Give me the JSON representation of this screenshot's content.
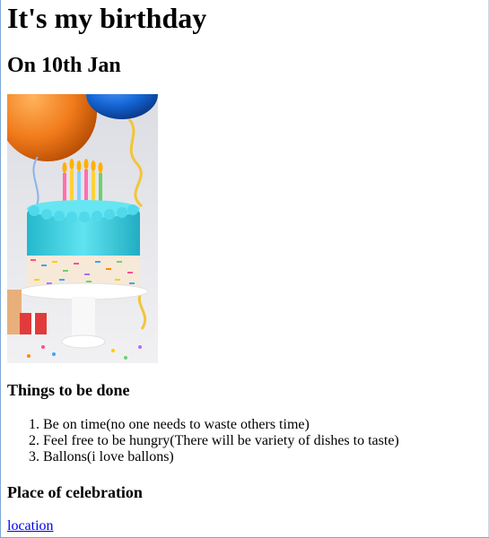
{
  "page": {
    "title": "It's my birthday",
    "subtitle": "On 10th Jan",
    "todo_heading": "Things to be done",
    "todo_items": [
      "Be on time(no one needs to waste others time)",
      "Feel free to be hungry(There will be variety of dishes to taste)",
      "Ballons(i love ballons)"
    ],
    "place_heading": "Place of celebration",
    "location_link": "location"
  },
  "image": {
    "semantic": "birthday-cake-with-balloons-photo",
    "colors": {
      "background": "#e8e8ec",
      "frosting": "#3fd3e4",
      "balloon_orange": "#f07a1a",
      "balloon_blue": "#1566d6",
      "stand": "#ffffff"
    }
  }
}
